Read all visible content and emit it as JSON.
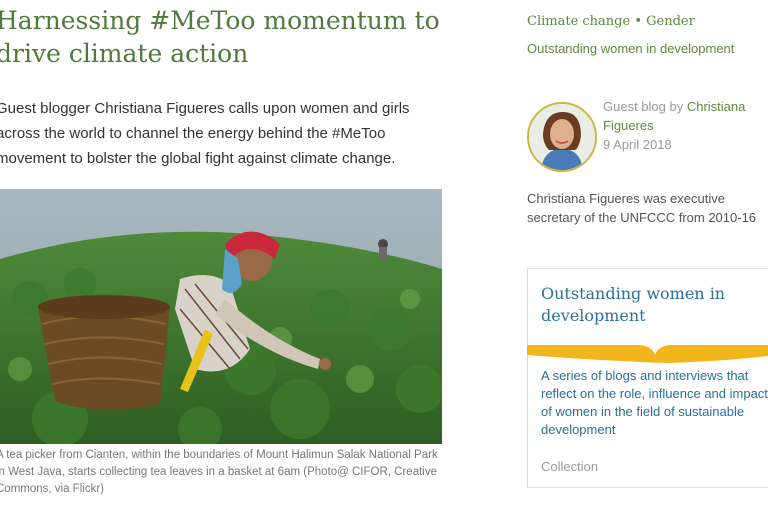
{
  "article": {
    "title": "Harnessing #MeToo momentum to drive climate action",
    "lead": "Guest blogger Christiana Figueres calls upon women and girls across the world to channel the energy behind the #MeToo movement to bolster the global fight against climate change.",
    "caption": "A tea picker from Cianten, within the boundaries of Mount Halimun Salak National Park in West Java, starts collecting tea leaves in a basket at 6am (Photo@ CIFOR, Creative Commons, via Flickr)"
  },
  "sidebar": {
    "tags": [
      "Climate change",
      "Gender"
    ],
    "tag_separator": "•",
    "series_link": "Outstanding women in development",
    "author": {
      "prefix": "Guest blog by",
      "name": "Christiana Figueres",
      "date": "9 April 2018",
      "bio": "Christiana Figueres was executive secretary of the UNFCCC from 2010-16"
    },
    "card": {
      "title": "Outstanding women in development",
      "description": "A series of blogs and interviews that reflect on the role, influence and impact of women in the field of sustainable development",
      "type": "Collection"
    }
  },
  "colors": {
    "heading_green": "#4e7a3a",
    "link_green": "#5a8a3c",
    "card_blue": "#2a6f9a",
    "accent_yellow": "#f2b51c"
  }
}
